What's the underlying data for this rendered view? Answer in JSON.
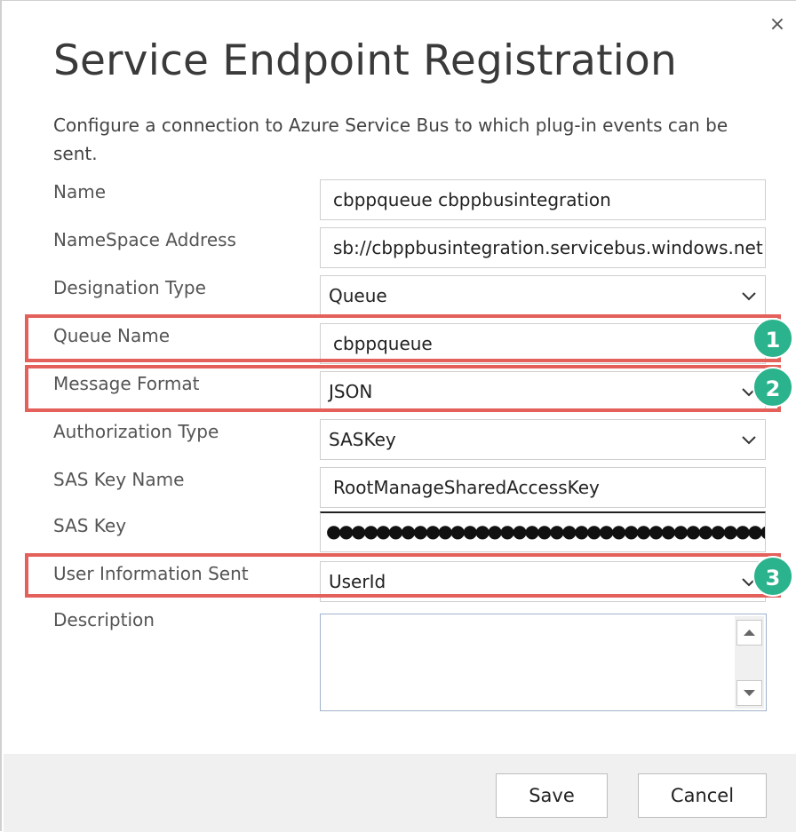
{
  "dialog": {
    "title": "Service Endpoint Registration",
    "subtitle": "Configure a connection to Azure Service Bus to which plug-in events can be sent.",
    "close_glyph": "×"
  },
  "form": {
    "name": {
      "label": "Name",
      "value": "cbppqueue cbppbusintegration"
    },
    "namespace_address": {
      "label": "NameSpace Address",
      "value": "sb://cbppbusintegration.servicebus.windows.net"
    },
    "designation_type": {
      "label": "Designation Type",
      "value": "Queue"
    },
    "queue_name": {
      "label": "Queue Name",
      "value": "cbppqueue"
    },
    "message_format": {
      "label": "Message Format",
      "value": "JSON"
    },
    "authorization_type": {
      "label": "Authorization Type",
      "value": "SASKey"
    },
    "sas_key_name": {
      "label": "SAS Key Name",
      "value": "RootManageSharedAccessKey"
    },
    "sas_key": {
      "label": "SAS Key",
      "masked_value": "●●●●●●●●●●●●●●●●●●●●●●●●●●●●●●●●●●●●●●●●●●●●"
    },
    "user_information_sent": {
      "label": "User Information Sent",
      "value": "UserId"
    },
    "description": {
      "label": "Description",
      "value": ""
    }
  },
  "callouts": [
    {
      "number": "1",
      "target": "Queue Name"
    },
    {
      "number": "2",
      "target": "Message Format"
    },
    {
      "number": "3",
      "target": "User Information Sent"
    }
  ],
  "buttons": {
    "save": "Save",
    "cancel": "Cancel"
  },
  "icons": {
    "close": "close-icon",
    "dropdown": "chevron-down-icon",
    "scroll_up": "arrow-up-icon",
    "scroll_down": "arrow-down-icon"
  },
  "colors": {
    "highlight": "#e4605b",
    "badge": "#2ab38c",
    "footer": "#f0f0f0"
  }
}
